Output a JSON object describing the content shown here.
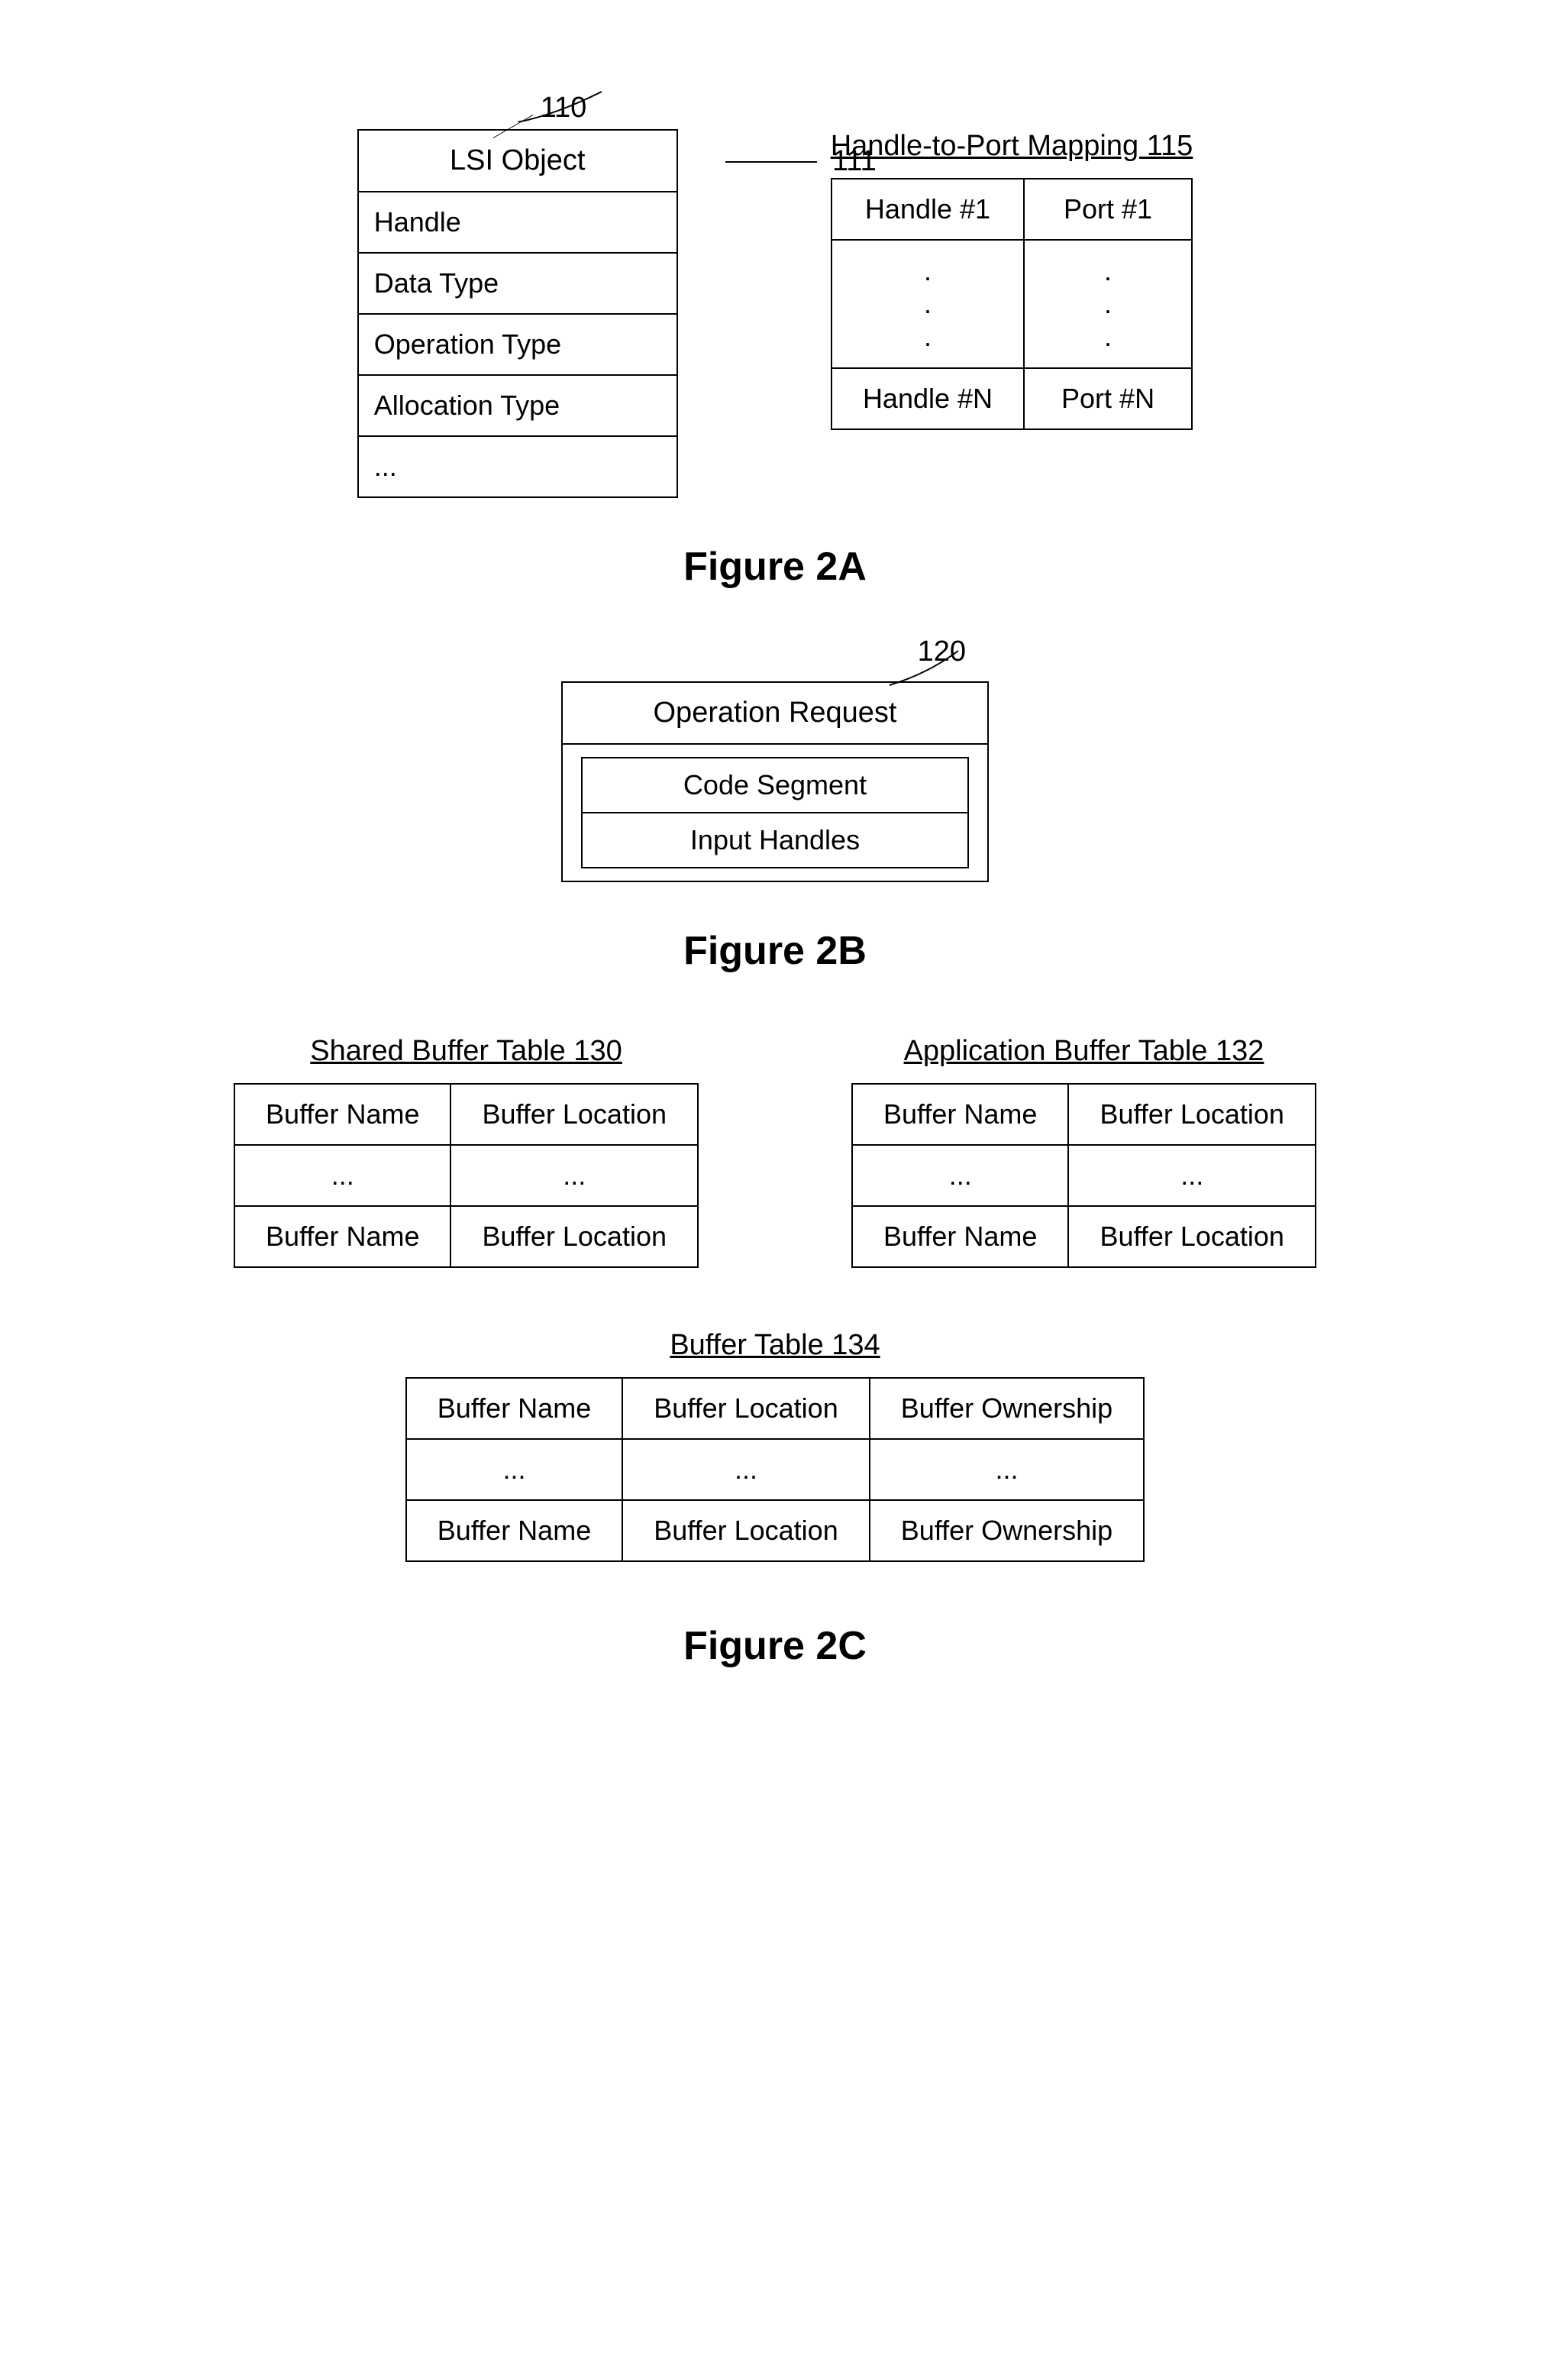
{
  "figure2a": {
    "label_110": "110",
    "label_111": "111",
    "lsi_object": {
      "title": "LSI Object",
      "fields": [
        "Handle",
        "Data Type",
        "Operation Type",
        "Allocation Type",
        "..."
      ]
    },
    "hpm_title": "Handle-to-Port Mapping 115",
    "hpm_table": {
      "header_row": [
        "Handle #1",
        "Port #1"
      ],
      "dots_col1": [
        ".",
        ".",
        "."
      ],
      "dots_col2": [
        ".",
        ".",
        "."
      ],
      "footer_row": [
        "Handle #N",
        "Port #N"
      ]
    },
    "caption": "Figure 2A"
  },
  "figure2b": {
    "label_120": "120",
    "operation_request": {
      "title": "Operation Request",
      "inner_rows": [
        "Code Segment",
        "Input Handles"
      ]
    },
    "caption": "Figure 2B"
  },
  "figure2c": {
    "shared_buffer_table": {
      "title": "Shared Buffer Table 130",
      "rows": [
        [
          "Buffer Name",
          "Buffer Location"
        ],
        [
          "...",
          "..."
        ],
        [
          "Buffer Name",
          "Buffer Location"
        ]
      ]
    },
    "app_buffer_table": {
      "title": "Application Buffer Table 132",
      "rows": [
        [
          "Buffer Name",
          "Buffer Location"
        ],
        [
          "...",
          "..."
        ],
        [
          "Buffer Name",
          "Buffer Location"
        ]
      ]
    },
    "buffer_table_134": {
      "title": "Buffer Table 134",
      "rows": [
        [
          "Buffer Name",
          "Buffer Location",
          "Buffer Ownership"
        ],
        [
          "...",
          "...",
          "..."
        ],
        [
          "Buffer Name",
          "Buffer Location",
          "Buffer Ownership"
        ]
      ]
    },
    "caption": "Figure 2C"
  }
}
